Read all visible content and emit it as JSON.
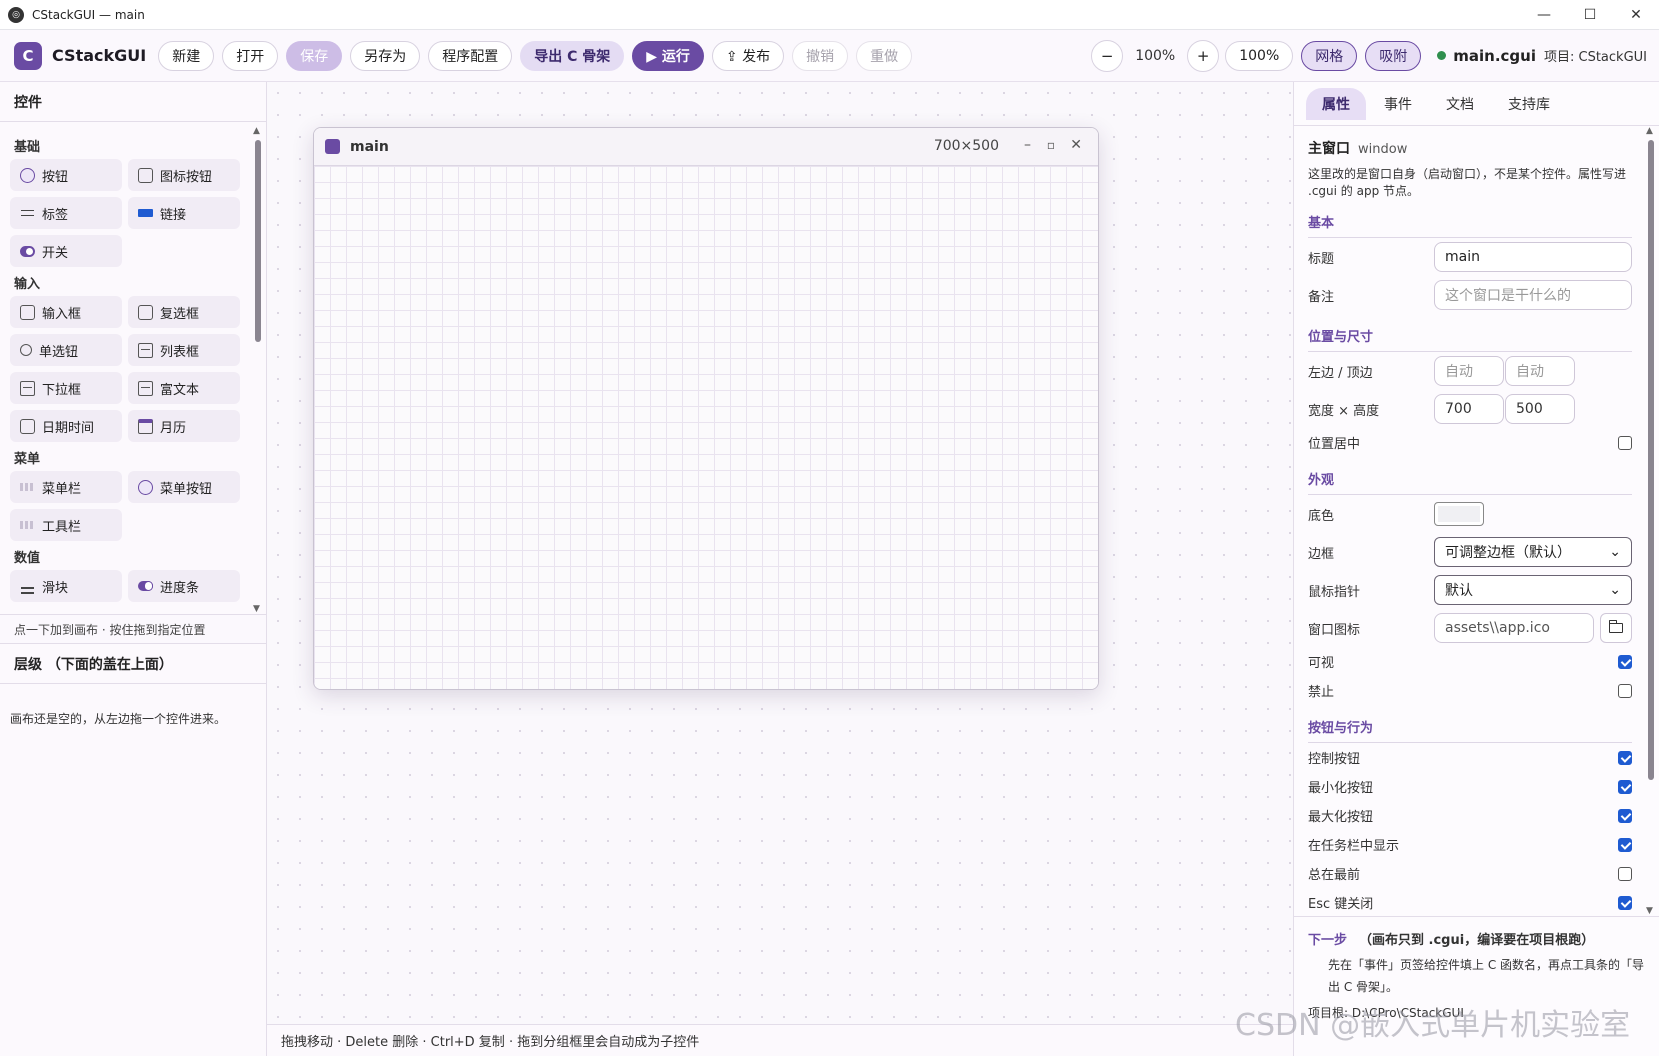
{
  "titlebar": {
    "title": "CStackGUI — main",
    "minimize": "—",
    "maximize": "☐",
    "close": "✕"
  },
  "toolbar": {
    "brand_letter": "C",
    "brand_name": "CStackGUI",
    "new": "新建",
    "open": "打开",
    "save": "保存",
    "save_as": "另存为",
    "program_config": "程序配置",
    "export_c": "导出 C 骨架",
    "run": "▶ 运行",
    "publish": "⇪ 发布",
    "undo": "撤销",
    "redo": "重做",
    "zoom_out": "−",
    "zoom_value": "100%",
    "zoom_in": "+",
    "zoom_reset": "100%",
    "grid": "网格",
    "snap": "吸附",
    "file_name": "main.cgui",
    "project": "项目: CStackGUI"
  },
  "left": {
    "title": "控件",
    "groups": [
      {
        "label": "基础",
        "items": [
          {
            "label": "按钮",
            "icon": "button-icon"
          },
          {
            "label": "图标按钮",
            "icon": "icon-button-icon"
          },
          {
            "label": "标签",
            "icon": "label-icon"
          },
          {
            "label": "链接",
            "icon": "link-icon"
          },
          {
            "label": "开关",
            "icon": "switch-icon"
          }
        ]
      },
      {
        "label": "输入",
        "items": [
          {
            "label": "输入框",
            "icon": "input-icon"
          },
          {
            "label": "复选框",
            "icon": "checkbox-icon"
          },
          {
            "label": "单选钮",
            "icon": "radio-icon"
          },
          {
            "label": "列表框",
            "icon": "listbox-icon"
          },
          {
            "label": "下拉框",
            "icon": "dropdown-icon"
          },
          {
            "label": "富文本",
            "icon": "richtext-icon"
          },
          {
            "label": "日期时间",
            "icon": "datetime-icon"
          },
          {
            "label": "月历",
            "icon": "calendar-icon"
          }
        ]
      },
      {
        "label": "菜单",
        "items": [
          {
            "label": "菜单栏",
            "icon": "menubar-icon"
          },
          {
            "label": "菜单按钮",
            "icon": "menu-button-icon"
          },
          {
            "label": "工具栏",
            "icon": "toolbar-icon"
          }
        ]
      },
      {
        "label": "数值",
        "items": [
          {
            "label": "滑块",
            "icon": "slider-icon"
          },
          {
            "label": "进度条",
            "icon": "progress-icon"
          }
        ]
      }
    ],
    "hint": "点一下加到画布 · 按住拖到指定位置",
    "layers_title": "层级 （下面的盖在上面）",
    "layers_empty": "画布还是空的，从左边拖一个控件进来。"
  },
  "canvas": {
    "window_name": "main",
    "window_size": "700×500",
    "min": "–",
    "max": "▫",
    "close": "✕"
  },
  "statusbar": "拖拽移动 · Delete 删除 · Ctrl+D 复制 · 拖到分组框里会自动成为子控件",
  "right": {
    "tabs": [
      "属性",
      "事件",
      "文档",
      "支持库"
    ],
    "heading": "主窗口",
    "heading_type": "window",
    "description": "这里改的是窗口自身（启动窗口），不是某个控件。属性写进 .cgui 的 app 节点。",
    "sections": {
      "basic": "基本",
      "position": "位置与尺寸",
      "appearance": "外观",
      "buttons": "按钮与行为"
    },
    "fields": {
      "title_label": "标题",
      "title_value": "main",
      "note_label": "备注",
      "note_placeholder": "这个窗口是干什么的",
      "lefttop_label": "左边 / 顶边",
      "left_placeholder": "自动",
      "top_placeholder": "自动",
      "size_label": "宽度 × 高度",
      "width": "700",
      "height": "500",
      "center_label": "位置居中",
      "bg_label": "底色",
      "bg_color": "#f0f0f3",
      "border_label": "边框",
      "border_value": "可调整边框（默认）",
      "cursor_label": "鼠标指针",
      "cursor_value": "默认",
      "icon_label": "窗口图标",
      "icon_value": "assets\\\\app.ico",
      "visible_label": "可视",
      "disabled_label": "禁止",
      "ctrlbox_label": "控制按钮",
      "minbtn_label": "最小化按钮",
      "maxbtn_label": "最大化按钮",
      "taskbar_label": "在任务栏中显示",
      "topmost_label": "总在最前",
      "esc_label": "Esc 键关闭"
    },
    "checks": {
      "center": false,
      "visible": true,
      "disabled": false,
      "ctrlbox": true,
      "minbtn": true,
      "maxbtn": true,
      "taskbar": true,
      "topmost": false,
      "esc": true
    },
    "next_step": {
      "key": "下一步",
      "title": "（画布只到 .cgui，编译要在项目根跑）",
      "body": "先在「事件」页签给控件填上 C 函数名，再点工具条的「导出 C 骨架」。",
      "root": "项目根: D:\\CPro\\CStackGUI"
    }
  },
  "watermark": "CSDN @嵌入式单片机实验室",
  "colors": {
    "accent": "#6a4ba3",
    "check": "#1f5bd1",
    "status_dot": "#2f8f4e"
  }
}
